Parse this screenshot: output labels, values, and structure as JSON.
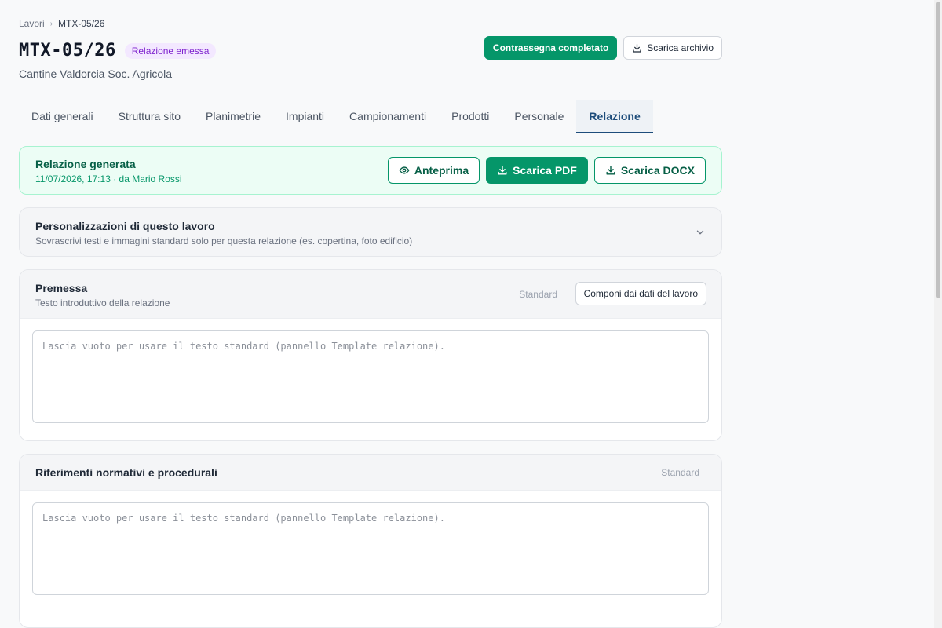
{
  "breadcrumb": {
    "parent": "Lavori",
    "separator": "›",
    "current": "MTX-05/26"
  },
  "header": {
    "job_code": "MTX-05/26",
    "status_badge": "Relazione emessa",
    "client": "Cantine Valdorcia Soc. Agricola",
    "mark_complete_label": "Contrassegna completato",
    "download_archive_label": "Scarica archivio"
  },
  "tabs": [
    {
      "label": "Dati generali"
    },
    {
      "label": "Struttura sito"
    },
    {
      "label": "Planimetrie"
    },
    {
      "label": "Impianti"
    },
    {
      "label": "Campionamenti"
    },
    {
      "label": "Prodotti"
    },
    {
      "label": "Personale"
    },
    {
      "label": "Relazione",
      "active": true
    }
  ],
  "generated": {
    "title": "Relazione generata",
    "meta": "11/07/2026, 17:13 · da Mario Rossi",
    "preview_label": "Anteprima",
    "pdf_label": "Scarica PDF",
    "docx_label": "Scarica DOCX"
  },
  "customization": {
    "title": "Personalizzazioni di questo lavoro",
    "subtitle": "Sovrascrivi testi e immagini standard solo per questa relazione (es. copertina, foto edificio)"
  },
  "sections": {
    "premessa": {
      "title": "Premessa",
      "subtitle": "Testo introduttivo della relazione",
      "standard_label": "Standard",
      "compose_label": "Componi dai dati del lavoro",
      "value": "",
      "placeholder": "Lascia vuoto per usare il testo standard (pannello Template relazione)."
    },
    "riferimenti": {
      "title": "Riferimenti normativi e procedurali",
      "standard_label": "Standard",
      "value": "",
      "placeholder": "Lascia vuoto per usare il testo standard (pannello Template relazione)."
    }
  },
  "colors": {
    "accent_green": "#059669",
    "tab_active": "#1e4d7b",
    "badge_purple": "#7e22ce"
  },
  "icons": [
    "chevron-right-icon",
    "download-icon",
    "eye-icon",
    "chevron-down-icon"
  ]
}
